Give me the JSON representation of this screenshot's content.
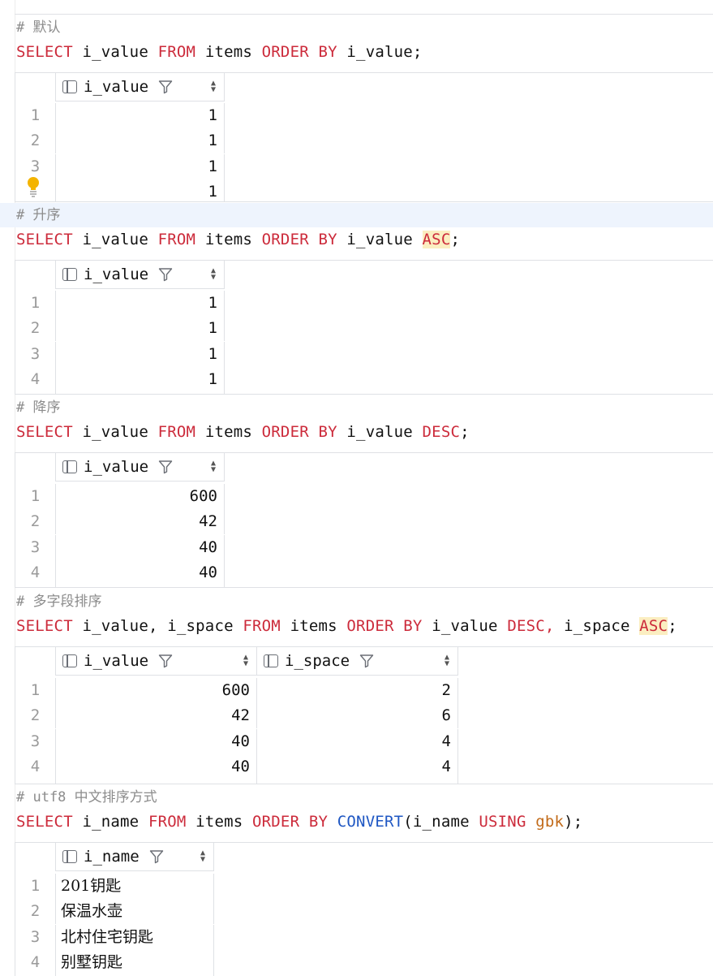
{
  "sections": [
    {
      "comment": "# 默认",
      "sql": [
        "SELECT",
        "i_value",
        "FROM",
        "items",
        "ORDER BY",
        "i_value",
        ";"
      ],
      "columns": [
        "i_value"
      ],
      "rows": [
        [
          "1"
        ],
        [
          "1"
        ],
        [
          "1"
        ],
        [
          "1"
        ]
      ],
      "row_numbers": [
        "1",
        "2",
        "3",
        ""
      ]
    },
    {
      "comment": "# 升序",
      "sql": [
        "SELECT",
        "i_value",
        "FROM",
        "items",
        "ORDER BY",
        "i_value",
        "ASC",
        ";"
      ],
      "columns": [
        "i_value"
      ],
      "rows": [
        [
          "1"
        ],
        [
          "1"
        ],
        [
          "1"
        ],
        [
          "1"
        ]
      ],
      "row_numbers": [
        "1",
        "2",
        "3",
        "4"
      ]
    },
    {
      "comment": "# 降序",
      "sql": [
        "SELECT",
        "i_value",
        "FROM",
        "items",
        "ORDER BY",
        "i_value",
        "DESC",
        ";"
      ],
      "columns": [
        "i_value"
      ],
      "rows": [
        [
          "600"
        ],
        [
          "42"
        ],
        [
          "40"
        ],
        [
          "40"
        ]
      ],
      "row_numbers": [
        "1",
        "2",
        "3",
        "4"
      ]
    },
    {
      "comment": "# 多字段排序",
      "sql": [
        "SELECT",
        "i_value,",
        "i_space",
        "FROM",
        "items",
        "ORDER BY",
        "i_value",
        "DESC,",
        "i_space",
        "ASC",
        ";"
      ],
      "columns": [
        "i_value",
        "i_space"
      ],
      "rows": [
        [
          "600",
          "2"
        ],
        [
          "42",
          "6"
        ],
        [
          "40",
          "4"
        ],
        [
          "40",
          "4"
        ]
      ],
      "row_numbers": [
        "1",
        "2",
        "3",
        "4"
      ]
    },
    {
      "comment": "# utf8 中文排序方式",
      "sql": [
        "SELECT",
        "i_name",
        "FROM",
        "items",
        "ORDER BY",
        "CONVERT",
        "(i_name",
        "USING",
        "gbk",
        ");"
      ],
      "columns": [
        "i_name"
      ],
      "rows": [
        [
          "201钥匙"
        ],
        [
          "保温水壶"
        ],
        [
          "北村住宅钥匙"
        ],
        [
          "别墅钥匙"
        ]
      ],
      "row_numbers": [
        "1",
        "2",
        "3",
        "4"
      ]
    }
  ],
  "icons": {
    "column_icon": "table-column-icon",
    "filter_icon": "filter-icon",
    "sort_icon": "sort-arrows-icon",
    "intention_icon": "lightbulb-icon"
  },
  "colors": {
    "keyword": "#cc2b3b",
    "function": "#1f57c3",
    "string": "#c26b1a",
    "comment": "#8c8c8c",
    "highlight": "#fbeec1"
  }
}
